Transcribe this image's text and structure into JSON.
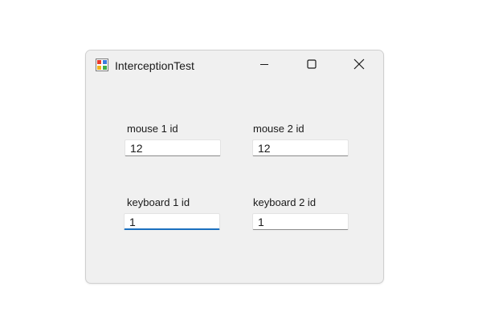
{
  "window": {
    "title": "InterceptionTest",
    "icon": "winforms-app-icon",
    "controls": {
      "minimize_icon": "minimize-icon",
      "maximize_icon": "maximize-icon",
      "close_icon": "close-icon"
    }
  },
  "fields": {
    "mouse1": {
      "label": "mouse 1 id",
      "value": "12"
    },
    "mouse2": {
      "label": "mouse 2 id",
      "value": "12"
    },
    "keyboard1": {
      "label": "keyboard 1 id",
      "value": "1",
      "focused": true
    },
    "keyboard2": {
      "label": "keyboard 2 id",
      "value": "1"
    }
  },
  "colors": {
    "window_bg": "#f0f0f0",
    "focus_accent": "#1a6fbf",
    "text": "#1a1a1a"
  }
}
